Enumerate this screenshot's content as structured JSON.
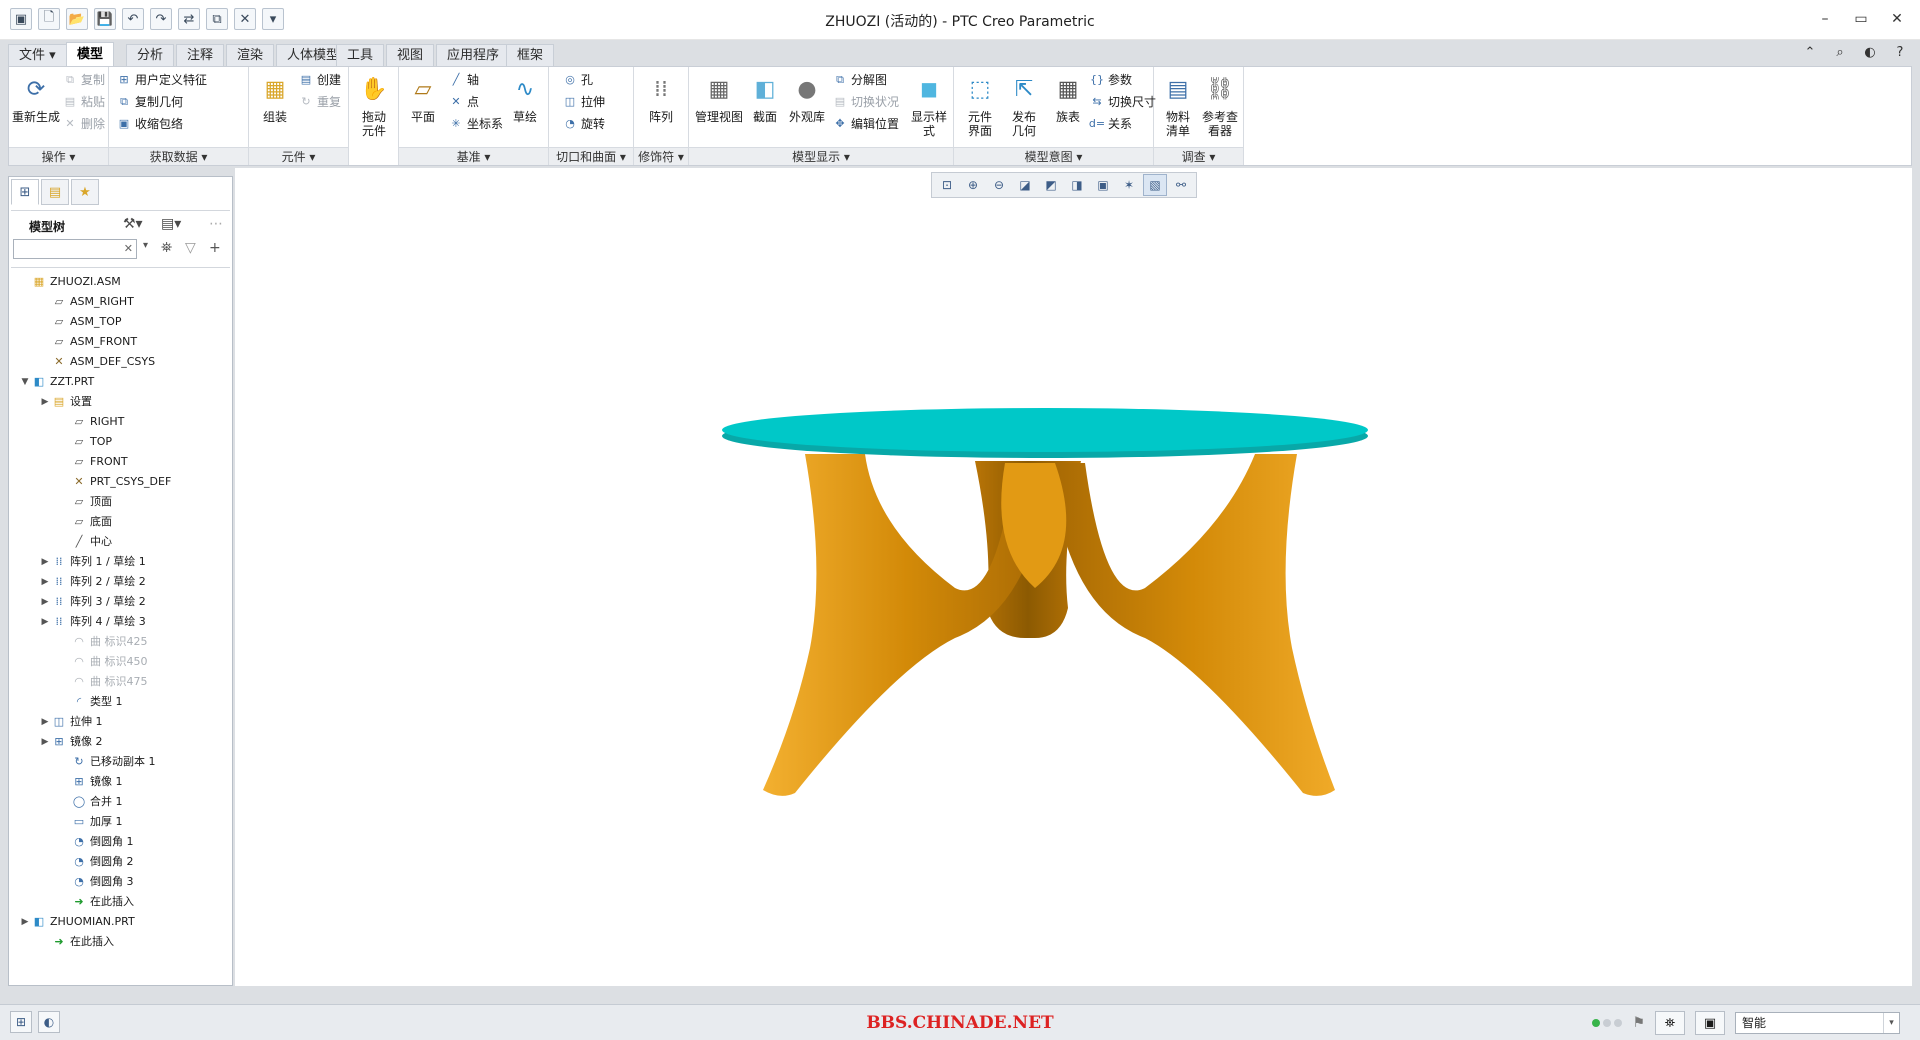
{
  "window": {
    "title": "ZHUOZI (活动的) - PTC Creo Parametric",
    "min": "–",
    "max": "▭",
    "close": "✕"
  },
  "qat": [
    "▣",
    "🗋",
    "📂",
    "💾",
    "↶",
    "↷",
    "⇄",
    "⧉",
    "✕",
    "▾"
  ],
  "tabs": [
    {
      "label": "文件 ▾",
      "active": false
    },
    {
      "label": "模型",
      "active": true
    },
    {
      "label": "分析",
      "active": false
    },
    {
      "label": "注释",
      "active": false
    },
    {
      "label": "渲染",
      "active": false
    },
    {
      "label": "人体模型",
      "active": false
    },
    {
      "label": "工具",
      "active": false
    },
    {
      "label": "视图",
      "active": false
    },
    {
      "label": "应用程序",
      "active": false
    },
    {
      "label": "框架",
      "active": false
    }
  ],
  "ribbon": {
    "groups": {
      "operations": "操作 ▾",
      "get_data": "获取数据 ▾",
      "component": "元件 ▾",
      "datum": "基准 ▾",
      "cut_surface": "切口和曲面 ▾",
      "modifier": "修饰符 ▾",
      "model_display": "模型显示 ▾",
      "model_intent": "模型意图 ▾",
      "investigate": "调查 ▾"
    },
    "regenerate": "重新生成",
    "copy": "复制",
    "paste": "粘贴",
    "delete": "删除",
    "udf": "用户定义特征",
    "copy_geom": "复制几何",
    "shrinkwrap": "收缩包络",
    "assemble": "组装",
    "create": "创建",
    "repeat": "重复",
    "drag": "拖动\n元件",
    "plane": "平面",
    "axis": "轴",
    "point": "点",
    "csys": "坐标系",
    "sketch": "草绘",
    "hole": "孔",
    "extrude": "拉伸",
    "revolve": "旋转",
    "pattern": "阵列",
    "manage_views": "管理视图",
    "section": "截面",
    "appearance": "外观库",
    "explode": "分解图",
    "toggle_status": "切换状况",
    "edit_position": "编辑位置",
    "display_style": "显示样\n式",
    "comp_interface": "元件\n界面",
    "publish_geom": "发布\n几何",
    "family_table": "族表",
    "parameters": "参数",
    "switch_dims": "切换尺寸",
    "relations": "关系",
    "bom": "物料\n清单",
    "ref_viewer": "参考查\n看器"
  },
  "right_icons": [
    "⌃",
    "⌕",
    "◐",
    "?"
  ],
  "panel": {
    "title": "模型树",
    "search_placeholder": ""
  },
  "tree": [
    {
      "label": "ZHUOZI.ASM",
      "icon": "▦",
      "color": "#d9a62a",
      "indent": 0,
      "toggle": "",
      "gray": false
    },
    {
      "label": "ASM_RIGHT",
      "icon": "▱",
      "color": "#555",
      "indent": 1,
      "toggle": "",
      "gray": false
    },
    {
      "label": "ASM_TOP",
      "icon": "▱",
      "color": "#555",
      "indent": 1,
      "toggle": "",
      "gray": false
    },
    {
      "label": "ASM_FRONT",
      "icon": "▱",
      "color": "#555",
      "indent": 1,
      "toggle": "",
      "gray": false
    },
    {
      "label": "ASM_DEF_CSYS",
      "icon": "✕",
      "color": "#8a6a2a",
      "indent": 1,
      "toggle": "",
      "gray": false
    },
    {
      "label": "ZZT.PRT",
      "icon": "◧",
      "color": "#2d8ac7",
      "indent": 0,
      "toggle": "▼",
      "gray": false
    },
    {
      "label": "设置",
      "icon": "▤",
      "color": "#d9a62a",
      "indent": 1,
      "toggle": "▶",
      "gray": false
    },
    {
      "label": "RIGHT",
      "icon": "▱",
      "color": "#555",
      "indent": 2,
      "toggle": "",
      "gray": false
    },
    {
      "label": "TOP",
      "icon": "▱",
      "color": "#555",
      "indent": 2,
      "toggle": "",
      "gray": false
    },
    {
      "label": "FRONT",
      "icon": "▱",
      "color": "#555",
      "indent": 2,
      "toggle": "",
      "gray": false
    },
    {
      "label": "PRT_CSYS_DEF",
      "icon": "✕",
      "color": "#8a6a2a",
      "indent": 2,
      "toggle": "",
      "gray": false
    },
    {
      "label": "顶面",
      "icon": "▱",
      "color": "#555",
      "indent": 2,
      "toggle": "",
      "gray": false
    },
    {
      "label": "底面",
      "icon": "▱",
      "color": "#555",
      "indent": 2,
      "toggle": "",
      "gray": false
    },
    {
      "label": "中心",
      "icon": "╱",
      "color": "#555",
      "indent": 2,
      "toggle": "",
      "gray": false
    },
    {
      "label": "阵列 1 / 草绘 1",
      "icon": "⁞⁞",
      "color": "#3d6fa8",
      "indent": 1,
      "toggle": "▶",
      "gray": false
    },
    {
      "label": "阵列 2 / 草绘 2",
      "icon": "⁞⁞",
      "color": "#3d6fa8",
      "indent": 1,
      "toggle": "▶",
      "gray": false
    },
    {
      "label": "阵列 3 / 草绘 2",
      "icon": "⁞⁞",
      "color": "#3d6fa8",
      "indent": 1,
      "toggle": "▶",
      "gray": false
    },
    {
      "label": "阵列 4 / 草绘 3",
      "icon": "⁞⁞",
      "color": "#3d6fa8",
      "indent": 1,
      "toggle": "▶",
      "gray": false
    },
    {
      "label": "曲 标识425",
      "icon": "◠",
      "color": "#a8adb3",
      "indent": 2,
      "toggle": "",
      "gray": true
    },
    {
      "label": "曲 标识450",
      "icon": "◠",
      "color": "#a8adb3",
      "indent": 2,
      "toggle": "",
      "gray": true
    },
    {
      "label": "曲 标识475",
      "icon": "◠",
      "color": "#a8adb3",
      "indent": 2,
      "toggle": "",
      "gray": true
    },
    {
      "label": "类型 1",
      "icon": "◜",
      "color": "#3d6fa8",
      "indent": 2,
      "toggle": "",
      "gray": false
    },
    {
      "label": "拉伸 1",
      "icon": "◫",
      "color": "#3d6fa8",
      "indent": 1,
      "toggle": "▶",
      "gray": false
    },
    {
      "label": "镜像 2",
      "icon": "⊞",
      "color": "#3d6fa8",
      "indent": 1,
      "toggle": "▶",
      "gray": false
    },
    {
      "label": "已移动副本 1",
      "icon": "↻",
      "color": "#3d6fa8",
      "indent": 2,
      "toggle": "",
      "gray": false
    },
    {
      "label": "镜像 1",
      "icon": "⊞",
      "color": "#3d6fa8",
      "indent": 2,
      "toggle": "",
      "gray": false
    },
    {
      "label": "合并 1",
      "icon": "◯",
      "color": "#3d6fa8",
      "indent": 2,
      "toggle": "",
      "gray": false
    },
    {
      "label": "加厚 1",
      "icon": "▭",
      "color": "#3d6fa8",
      "indent": 2,
      "toggle": "",
      "gray": false
    },
    {
      "label": "倒圆角 1",
      "icon": "◔",
      "color": "#3d6fa8",
      "indent": 2,
      "toggle": "",
      "gray": false
    },
    {
      "label": "倒圆角 2",
      "icon": "◔",
      "color": "#3d6fa8",
      "indent": 2,
      "toggle": "",
      "gray": false
    },
    {
      "label": "倒圆角 3",
      "icon": "◔",
      "color": "#3d6fa8",
      "indent": 2,
      "toggle": "",
      "gray": false
    },
    {
      "label": "在此插入",
      "icon": "➜",
      "color": "#1f9a2e",
      "indent": 2,
      "toggle": "",
      "gray": false
    },
    {
      "label": "ZHUOMIAN.PRT",
      "icon": "◧",
      "color": "#2d8ac7",
      "indent": 0,
      "toggle": "▶",
      "gray": false
    },
    {
      "label": "在此插入",
      "icon": "➜",
      "color": "#1f9a2e",
      "indent": 1,
      "toggle": "",
      "gray": false
    }
  ],
  "view_toolbar": [
    "⊡",
    "⊕",
    "⊖",
    "◪",
    "◩",
    "◨",
    "▣",
    "✶",
    "▧",
    "⚯"
  ],
  "status": {
    "watermark": "BBS.CHINADE.NET",
    "filter": "智能"
  },
  "model_colors": {
    "top": "#00c8c8",
    "top_edge": "#08a8a8",
    "legs": "#e39a10",
    "legs_dark": "#a86a04"
  }
}
